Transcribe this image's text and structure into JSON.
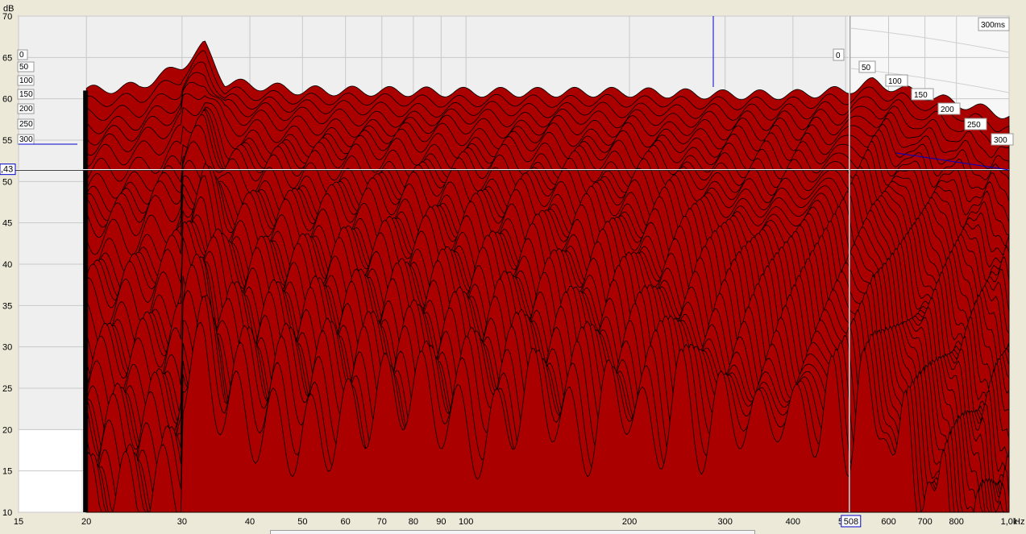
{
  "chart_data": {
    "type": "waterfall",
    "y_unit": "dB",
    "x_unit": "Hz",
    "ylim": [
      10,
      70
    ],
    "xlim": [
      15,
      1000
    ],
    "y_ticks": [
      "10",
      "15",
      "20",
      "25",
      "30",
      "35",
      "40",
      "45",
      "50",
      "55",
      "60",
      "65",
      "70"
    ],
    "x_ticks": [
      {
        "f": 15,
        "label": "15"
      },
      {
        "f": 20,
        "label": "20"
      },
      {
        "f": 30,
        "label": "30"
      },
      {
        "f": 40,
        "label": "40"
      },
      {
        "f": 50,
        "label": "50"
      },
      {
        "f": 60,
        "label": "60"
      },
      {
        "f": 70,
        "label": "70"
      },
      {
        "f": 80,
        "label": "80"
      },
      {
        "f": 90,
        "label": "90"
      },
      {
        "f": 100,
        "label": "100"
      },
      {
        "f": 200,
        "label": "200"
      },
      {
        "f": 300,
        "label": "300"
      },
      {
        "f": 400,
        "label": "400"
      },
      {
        "f": 500,
        "label": "500"
      },
      {
        "f": 600,
        "label": "600"
      },
      {
        "f": 700,
        "label": "700"
      },
      {
        "f": 800,
        "label": "800"
      },
      {
        "f": 1000,
        "label": "1,0k"
      }
    ],
    "time_unit": "ms",
    "time_slices": [
      "0",
      "50",
      "100",
      "150",
      "200",
      "250",
      "300"
    ],
    "time_span_label": "300ms",
    "cursor": {
      "freq_label": "508",
      "level_label": ",43",
      "freq": 508,
      "level": 51.43
    },
    "slice_count": 38,
    "peaks_at_0ms": [
      {
        "f": 20,
        "db": 61
      },
      {
        "f": 25,
        "db": 61.5
      },
      {
        "f": 30,
        "db": 64
      },
      {
        "f": 33,
        "db": 66.5
      },
      {
        "f": 36,
        "db": 62
      },
      {
        "f": 50,
        "db": 61
      },
      {
        "f": 100,
        "db": 60.8
      },
      {
        "f": 200,
        "db": 60.8
      },
      {
        "f": 300,
        "db": 60.5
      },
      {
        "f": 400,
        "db": 60.5
      },
      {
        "f": 500,
        "db": 61
      },
      {
        "f": 560,
        "db": 62
      }
    ],
    "grid": true,
    "colors": {
      "fill": "#aa0000",
      "stroke": "#000000",
      "cursor": "#ffffff",
      "marker": "#0000cc"
    }
  },
  "labels": {
    "y_unit_label": "dB",
    "time_span": "300ms"
  }
}
